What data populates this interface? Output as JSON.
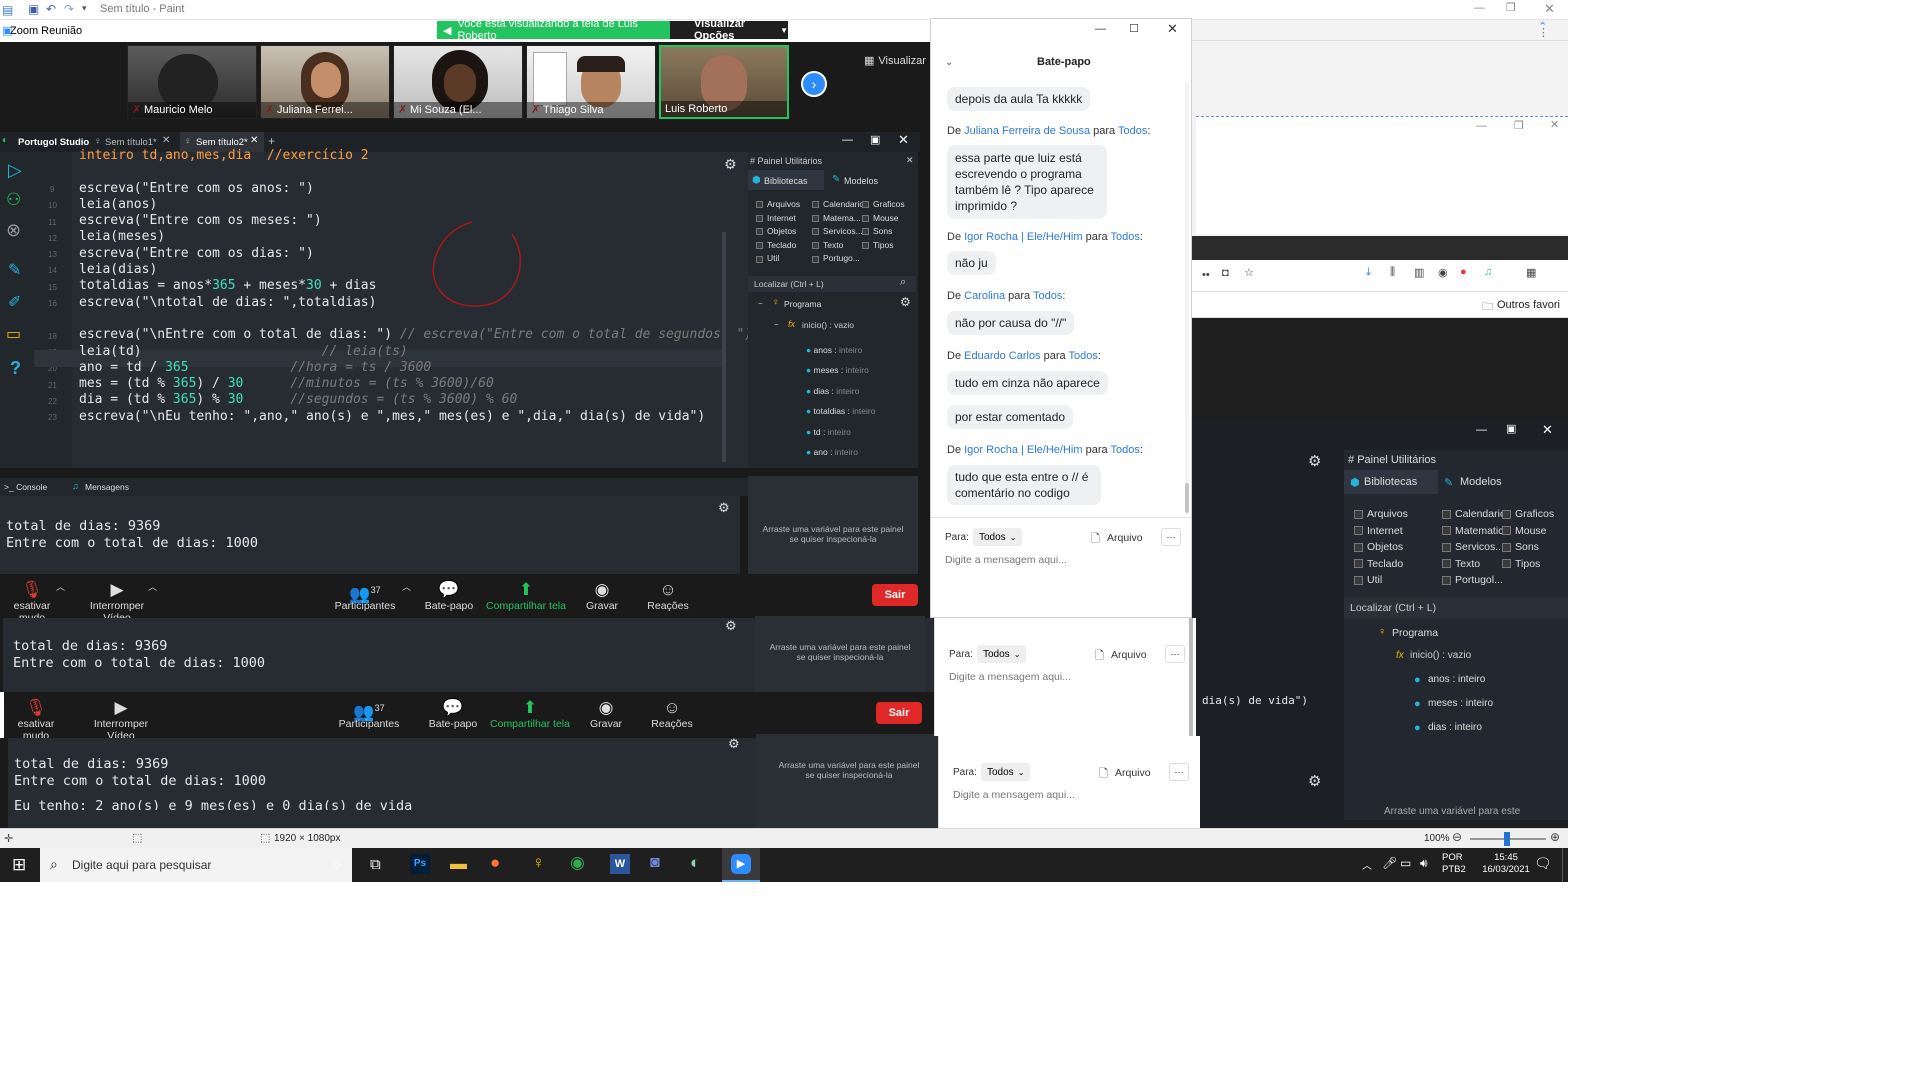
{
  "paint": {
    "title": "Sem título - Paint"
  },
  "zoom": {
    "window_title": "Zoom Reunião",
    "share_banner": "Você está visualizando a tela de Luis Roberto",
    "view_options": "Visualizar Opções",
    "view_button": "Visualizar",
    "participants": [
      {
        "name": "Mauricio Melo",
        "muted": true
      },
      {
        "name": "Juliana Ferrei...",
        "muted": true
      },
      {
        "name": "Mi Souza (El...",
        "muted": true
      },
      {
        "name": "Thiago Silva",
        "muted": true
      },
      {
        "name": "Luis Roberto",
        "muted": false
      }
    ],
    "toolbar": {
      "mute": "esativar mudo",
      "video": "Interromper Vídeo",
      "participants": "Participantes",
      "participants_count": "37",
      "chat": "Bate-papo",
      "share": "Compartilhar tela",
      "record": "Gravar",
      "reactions": "Reações",
      "leave": "Sair"
    }
  },
  "portugol": {
    "app_name": "Portugol Studio",
    "tabs": [
      "Sem título1*",
      "Sem título2*"
    ],
    "code_first_line": "inteiro td,ano,mes,dia  //exercício 2",
    "line_numbers": [
      "9",
      "10",
      "11",
      "12",
      "13",
      "14",
      "15",
      "16",
      "",
      "18",
      "19",
      "20",
      "21",
      "22",
      "23"
    ],
    "panel_title": "Painel Utilitários",
    "panel_tabs": [
      "Bibliotecas",
      "Modelos"
    ],
    "libs": [
      [
        "Arquivos",
        "Calendario",
        "Graficos"
      ],
      [
        "Internet",
        "Matema...",
        "Mouse"
      ],
      [
        "Objetos",
        "Servicos...",
        "Sons"
      ],
      [
        "Teclado",
        "Texto",
        "Tipos"
      ],
      [
        "Util",
        "Portugo..."
      ]
    ],
    "search_placeholder": "Localizar (Ctrl + L)",
    "tree_root": "Programa",
    "tree_func": "inicio() : vazio",
    "tree_vars": [
      [
        "anos",
        "inteiro"
      ],
      [
        "meses",
        "inteiro"
      ],
      [
        "dias",
        "inteiro"
      ],
      [
        "totaldias",
        "inteiro"
      ],
      [
        "td",
        "inteiro"
      ],
      [
        "ano",
        "inteiro"
      ]
    ],
    "console_tab": "Console",
    "messages_tab": "Mensagens",
    "console_lines": [
      "total de dias: 9369",
      "Entre com o total de dias: 1000"
    ],
    "console_line3": "Eu tenho: 2 ano(s) e 9 mes(es) e 0 dia(s) de vida",
    "inspect_hint": "Arraste uma variável para este painel se quiser inspecioná-la"
  },
  "chat": {
    "title": "Bate-papo",
    "messages": [
      {
        "from": "",
        "to": "",
        "texts": [
          "depois da aula Ta kkkkk"
        ]
      },
      {
        "from": "Juliana Ferreira de Sousa",
        "to": "Todos",
        "texts": [
          "essa parte que luiz está escrevendo o  programa também lê ? Tipo aparece imprimido  ?"
        ]
      },
      {
        "from": "Igor Rocha | Ele/He/Him",
        "to": "Todos",
        "texts": [
          "não ju"
        ]
      },
      {
        "from": "Carolina",
        "to": "Todos",
        "texts": [
          "não por causa do \"//\""
        ]
      },
      {
        "from": "Eduardo Carlos",
        "to": "Todos",
        "texts": [
          "tudo em cinza não aparece",
          "por estar comentado"
        ]
      },
      {
        "from": "Igor Rocha | Ele/He/Him",
        "to": "Todos",
        "texts": [
          "tudo que esta entre o // é comentário no codigo"
        ]
      }
    ],
    "de": "De",
    "para": "para",
    "to_label": "Para:",
    "to_value": "Todos",
    "file": "Arquivo",
    "input_placeholder": "Digite a mensagem aqui..."
  },
  "browser": {
    "other_favorites": "Outros favori"
  },
  "right_code_fragment": "dia(s) de vida\")",
  "statusbar": {
    "size": "1920 × 1080px",
    "zoom": "100%"
  },
  "taskbar": {
    "search_placeholder": "Digite aqui para pesquisar",
    "lang": "POR",
    "layout": "PTB2",
    "time": "15:45",
    "date": "16/03/2021"
  }
}
